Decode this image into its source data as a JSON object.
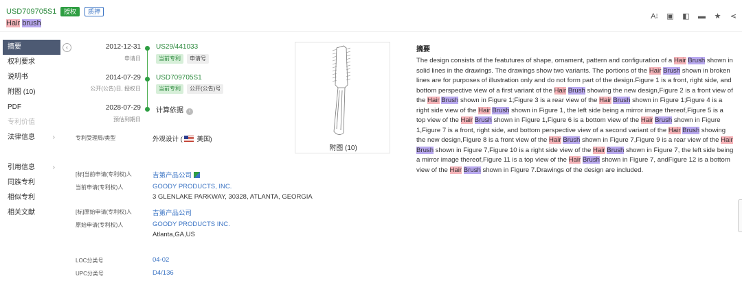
{
  "header": {
    "pub_number": "USD709705S1",
    "badge_grant": "授权",
    "badge_pledge": "质押",
    "title_parts": [
      {
        "text": "Hair",
        "hl": "r"
      },
      {
        "text": " ",
        "hl": ""
      },
      {
        "text": "brush",
        "hl": "b"
      }
    ],
    "tools": [
      {
        "name": "translate-icon",
        "glyph": "A⁝"
      },
      {
        "name": "share-export-icon",
        "glyph": "▣"
      },
      {
        "name": "pdf-download-icon",
        "glyph": "◧"
      },
      {
        "name": "folder-icon",
        "glyph": "▬"
      },
      {
        "name": "star-icon",
        "glyph": "★"
      },
      {
        "name": "share-icon",
        "glyph": "⋖"
      }
    ]
  },
  "sidebar": {
    "collapse_glyph": "‹",
    "items": [
      {
        "label": "摘要",
        "state": "active",
        "arrow": ""
      },
      {
        "label": "权利要求",
        "state": "",
        "arrow": ""
      },
      {
        "label": "说明书",
        "state": "",
        "arrow": ""
      },
      {
        "label": "附图 (10)",
        "state": "",
        "arrow": ""
      },
      {
        "label": "PDF",
        "state": "",
        "arrow": ""
      },
      {
        "label": "专利价值",
        "state": "disabled",
        "arrow": ""
      },
      {
        "label": "法律信息",
        "state": "",
        "arrow": "›"
      },
      {
        "label": "",
        "state": "spacer",
        "arrow": ""
      },
      {
        "label": "引用信息",
        "state": "",
        "arrow": "›"
      },
      {
        "label": "同族专利",
        "state": "",
        "arrow": ""
      },
      {
        "label": "相似专利",
        "state": "",
        "arrow": ""
      },
      {
        "label": "相关文献",
        "state": "",
        "arrow": ""
      }
    ]
  },
  "timeline": {
    "app": {
      "date": "2012-12-31",
      "sub": "申请日",
      "value": "US29/441033",
      "tags": [
        "当前专利",
        "申请号"
      ]
    },
    "pub": {
      "date": "2014-07-29",
      "sub": "公开(公告)日, 授权日",
      "value": "USD709705S1",
      "tags": [
        "当前专利",
        "公开(公告)号"
      ]
    },
    "exp": {
      "date": "2028-07-29",
      "sub": "预估到期日",
      "value": "计算依据",
      "info": "i"
    }
  },
  "drawing": {
    "label": "附图 (10)"
  },
  "details": {
    "office_label": "专利受理局/类型",
    "office_value_pre": "外观设计 (",
    "office_value_post": " 美国)",
    "std_cur_label": "[标]当前申请(专利权)人",
    "std_cur_value": "吉第产品公司",
    "cur_label": "当前申请(专利权)人",
    "cur_value": "GOODY PRODUCTS, INC.",
    "cur_addr": "3 GLENLAKE PARKWAY, 30328, ATLANTA, GEORGIA",
    "std_orig_label": "[标]原始申请(专利权)人",
    "std_orig_value": "吉第产品公司",
    "orig_label": "原始申请(专利权)人",
    "orig_value": "GOODY PRODUCTS INC.",
    "orig_addr": "Atlanta,GA,US",
    "loc_label": "LOC分类号",
    "loc_value": "04-02",
    "upc_label": "UPC分类号",
    "upc_value": "D4/136"
  },
  "abstract": {
    "title": "摘要",
    "parts": [
      {
        "t": "The design consists of the featutures of shape, ornament, pattern and configuration of a "
      },
      {
        "t": "Hair",
        "h": "r"
      },
      {
        "t": " "
      },
      {
        "t": "Brush",
        "h": "b"
      },
      {
        "t": " shown in solid lines in the drawings. The drawings show two variants. The portions of the "
      },
      {
        "t": "Hair",
        "h": "r"
      },
      {
        "t": " "
      },
      {
        "t": "Brush",
        "h": "b"
      },
      {
        "t": " shown in broken lines are for purposes of illustration only and do not form part of the design.Figure 1 is a front, right side, and bottom perspective view of a first variant of the "
      },
      {
        "t": "Hair",
        "h": "r"
      },
      {
        "t": " "
      },
      {
        "t": "Brush",
        "h": "b"
      },
      {
        "t": " showing the new design,Figure 2 is a front view of the "
      },
      {
        "t": "Hair",
        "h": "r"
      },
      {
        "t": " "
      },
      {
        "t": "Brush",
        "h": "b"
      },
      {
        "t": " shown in Figure 1;Figure 3 is a rear view of the "
      },
      {
        "t": "Hair",
        "h": "r"
      },
      {
        "t": " "
      },
      {
        "t": "Brush",
        "h": "b"
      },
      {
        "t": " shown in Figure 1;Figure 4 is a right side view of the "
      },
      {
        "t": "Hair",
        "h": "r"
      },
      {
        "t": " "
      },
      {
        "t": "Brush",
        "h": "b"
      },
      {
        "t": " shown in Figure 1, the left side being a mirror image thereof,Figure 5 is a top view of the "
      },
      {
        "t": "Hair",
        "h": "r"
      },
      {
        "t": " "
      },
      {
        "t": "Brush",
        "h": "b"
      },
      {
        "t": " shown in Figure 1,Figure 6 is a bottom view of the "
      },
      {
        "t": "Hair",
        "h": "r"
      },
      {
        "t": " "
      },
      {
        "t": "Brush",
        "h": "b"
      },
      {
        "t": " shown in Figure 1,Figure 7 is a front, right side, and bottom perspective view of a second variant of the "
      },
      {
        "t": "Hair",
        "h": "r"
      },
      {
        "t": " "
      },
      {
        "t": "Brush",
        "h": "b"
      },
      {
        "t": " showing the new design,Figure 8 is a front view of the "
      },
      {
        "t": "Hair",
        "h": "r"
      },
      {
        "t": " "
      },
      {
        "t": "Brush",
        "h": "b"
      },
      {
        "t": " shown in Figure 7,Figure 9 is a rear view of the "
      },
      {
        "t": "Hair",
        "h": "r"
      },
      {
        "t": " "
      },
      {
        "t": "Brush",
        "h": "b"
      },
      {
        "t": " shown in Figure 7,Figure 10 is a right side view of the "
      },
      {
        "t": "Hair",
        "h": "r"
      },
      {
        "t": " "
      },
      {
        "t": "Brush",
        "h": "b"
      },
      {
        "t": " shown in Figure 7, the left side being a mirror image thereof,Figure 11 is a top view of the "
      },
      {
        "t": "Hair",
        "h": "r"
      },
      {
        "t": " "
      },
      {
        "t": "Brush",
        "h": "b"
      },
      {
        "t": " shown in Figure 7, andFigure 12 is a bottom view of the "
      },
      {
        "t": "Hair",
        "h": "r"
      },
      {
        "t": " "
      },
      {
        "t": "Brush",
        "h": "b"
      },
      {
        "t": " shown in Figure 7.Drawings of the design are included."
      }
    ]
  },
  "colors": {
    "brand_green": "#2e9e42",
    "link_blue": "#3b74c4",
    "sidebar_active": "#4d5a73",
    "hl_hair": "#f5b3b8",
    "hl_brush": "#b9a9f0"
  }
}
